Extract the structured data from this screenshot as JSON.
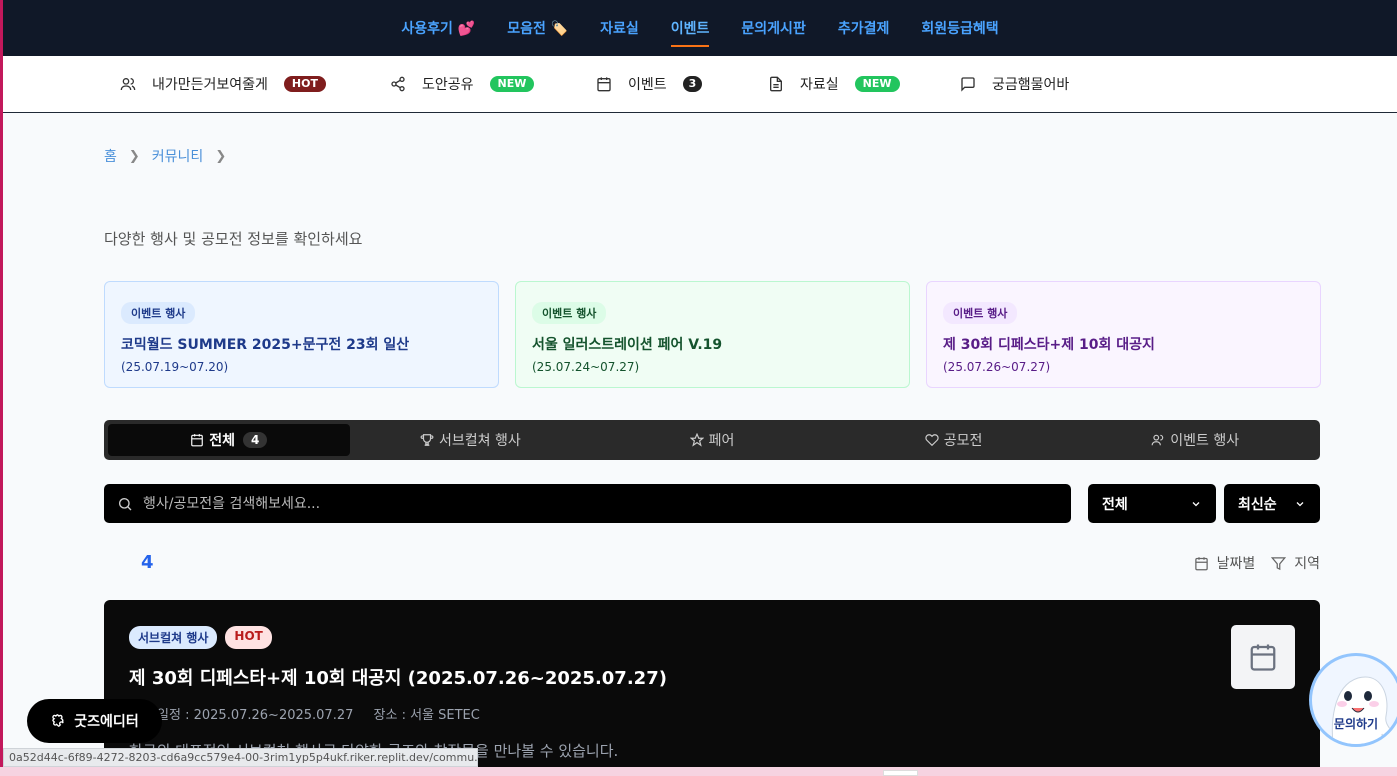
{
  "topnav": {
    "items": [
      {
        "label": "사용후기 💕"
      },
      {
        "label": "모음전 🏷️"
      },
      {
        "label": "자료실"
      },
      {
        "label": "이벤트",
        "active": true
      },
      {
        "label": "문의게시판"
      },
      {
        "label": "추가결제"
      },
      {
        "label": "회원등급혜택"
      }
    ]
  },
  "subnav": {
    "items": [
      {
        "label": "내가만든거보여줄게",
        "badge": "HOT",
        "icon": "users-icon"
      },
      {
        "label": "도안공유",
        "badge": "NEW",
        "icon": "share-icon"
      },
      {
        "label": "이벤트",
        "badge": "3",
        "icon": "calendar-icon"
      },
      {
        "label": "자료실",
        "badge": "NEW",
        "icon": "document-icon"
      },
      {
        "label": "궁금햄물어바",
        "badge": "",
        "icon": "message-icon"
      }
    ]
  },
  "breadcrumb": {
    "home": "홈",
    "community": "커뮤니티"
  },
  "subtitle": "다양한 행사 및 공모전 정보를 확인하세요",
  "featured": [
    {
      "tag": "이벤트 행사",
      "title": "코믹월드 SUMMER 2025+문구전 23회 일산",
      "date": "(25.07.19~07.20)"
    },
    {
      "tag": "이벤트 행사",
      "title": "서울 일러스트레이션 페어 V.19",
      "date": "(25.07.24~07.27)"
    },
    {
      "tag": "이벤트 행사",
      "title": "제 30회 디페스타+제 10회 대공지",
      "date": "(25.07.26~07.27)"
    }
  ],
  "tabs": {
    "all": "전체",
    "all_count": "4",
    "subculture": "서브컬쳐 행사",
    "fair": "페어",
    "contest": "공모전",
    "event": "이벤트 행사"
  },
  "search": {
    "placeholder": "행사/공모전을 검색해보세요..."
  },
  "filter_select": "전체",
  "sort_select": "최신순",
  "result_count": "4",
  "view_filters": {
    "by_date": "날짜별",
    "by_region": "지역"
  },
  "event": {
    "tag1": "서브컬쳐 행사",
    "tag2": "HOT",
    "title": "제 30회 디페스타+제 10회 대공지 (2025.07.26~2025.07.27)",
    "schedule": "접수 일정 : 2025.07.26~2025.07.27",
    "place": "장소 : 서울 SETEC",
    "desc": "한국의 대표적인 서브컬쳐 행사로 다양한 굿즈와 창작물을 만나볼 수 있습니다."
  },
  "goods_editor": "굿즈에디터",
  "help_label": "문의하기",
  "status_url": "0a52d44c-6f89-4272-8203-cd6a9cc579e4-00-3rim1yp5p4ukf.riker.replit.dev/commu..."
}
